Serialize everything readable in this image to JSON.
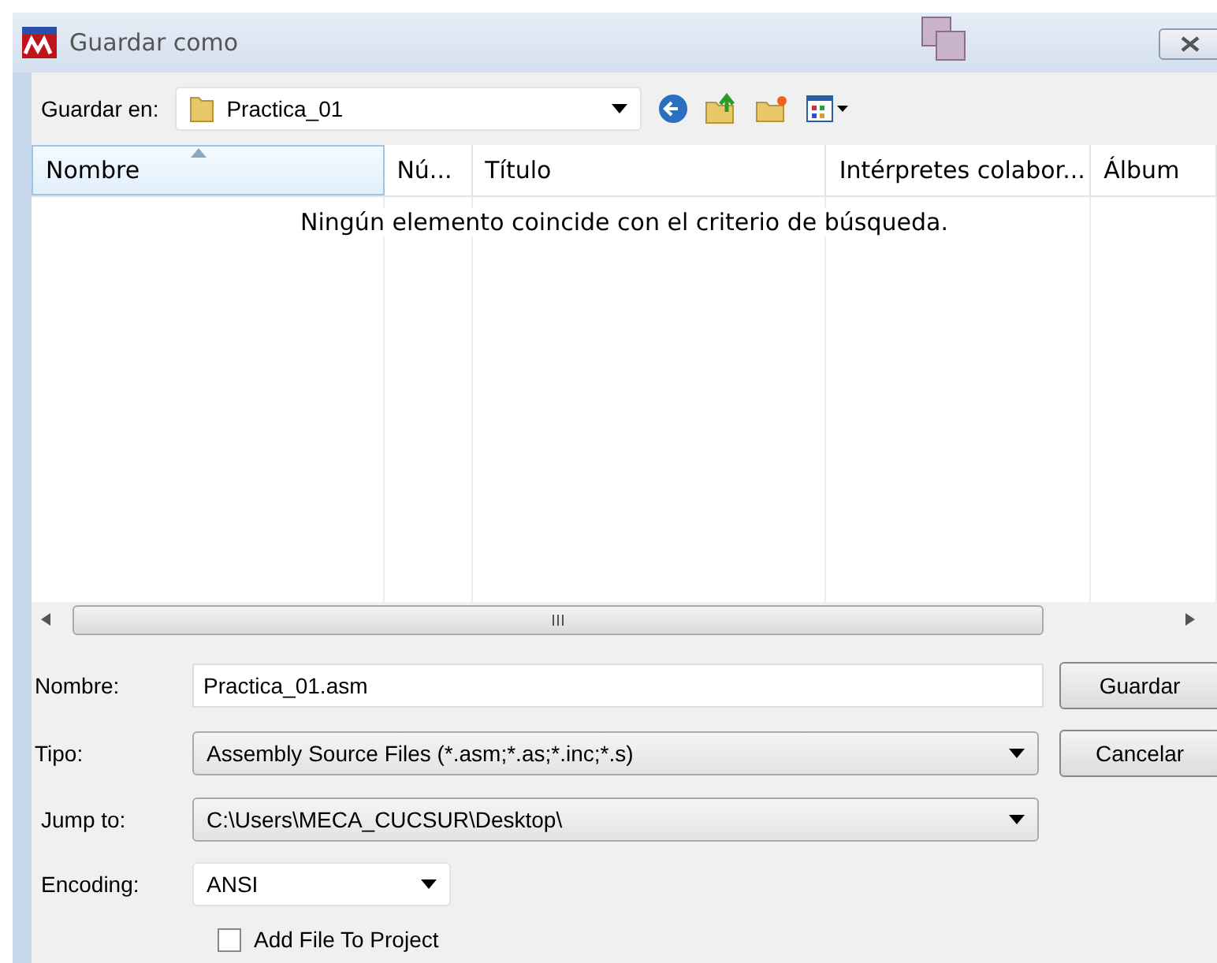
{
  "window": {
    "title": "Guardar como"
  },
  "toolbar": {
    "label": "Guardar en:",
    "folder": "Practica_01"
  },
  "list": {
    "columns": [
      {
        "label": "Nombre",
        "sorted": true
      },
      {
        "label": "Nú...",
        "sorted": false
      },
      {
        "label": "Título",
        "sorted": false
      },
      {
        "label": "Intérpretes colabor...",
        "sorted": false
      },
      {
        "label": "Álbum",
        "sorted": false
      }
    ],
    "empty_message": "Ningún elemento coincide con el criterio de búsqueda."
  },
  "fields": [
    {
      "kind": "text",
      "label": "Nombre:",
      "value": "Practica_01.asm"
    },
    {
      "kind": "combo",
      "label": "Tipo:",
      "value": "Assembly Source Files (*.asm;*.as;*.inc;*.s)"
    },
    {
      "kind": "combo",
      "label": "Jump to:",
      "value": "C:\\Users\\MECA_CUCSUR\\Desktop\\"
    },
    {
      "kind": "small-combo",
      "label": "Encoding:",
      "value": "ANSI"
    }
  ],
  "buttons": [
    "Guardar",
    "Cancelar"
  ],
  "add_to_project": {
    "label": "Add File To Project",
    "checked": false
  }
}
